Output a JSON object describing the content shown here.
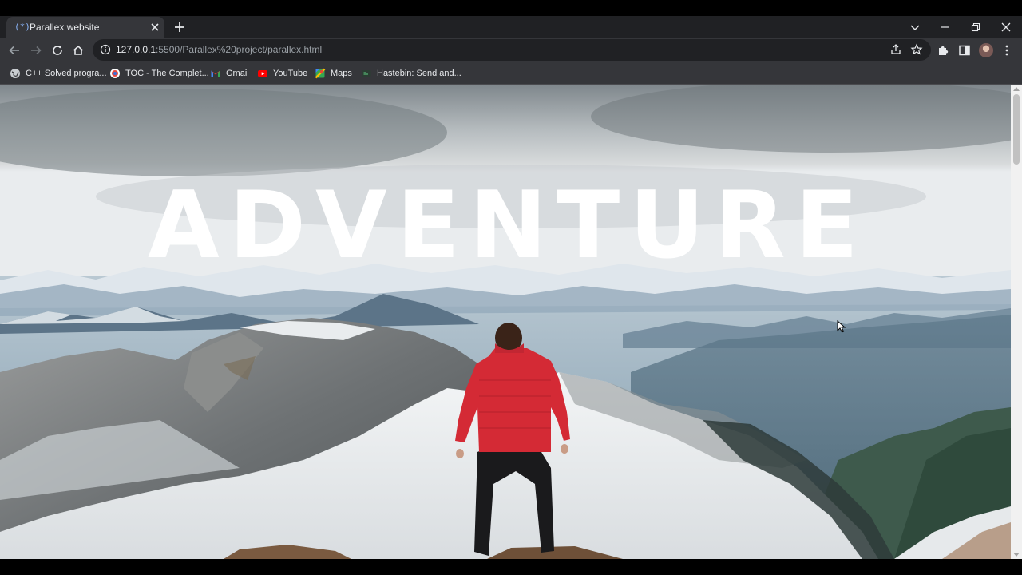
{
  "browser": {
    "tab": {
      "title": "Parallex website",
      "favicon": "code-favicon-icon",
      "favicon_glyph": "(*)"
    },
    "address": {
      "host": "127.0.0.1",
      "path": ":5500/Parallex%20project/parallex.html"
    },
    "bookmarks": [
      {
        "label": "C++ Solved progra...",
        "icon": "globe-icon"
      },
      {
        "label": "TOC - The Complet...",
        "icon": "site-favicon-icon"
      },
      {
        "label": "Gmail",
        "icon": "gmail-icon"
      },
      {
        "label": "YouTube",
        "icon": "youtube-icon"
      },
      {
        "label": "Maps",
        "icon": "maps-icon"
      },
      {
        "label": "Hastebin: Send and...",
        "icon": "hastebin-icon"
      }
    ]
  },
  "page": {
    "headline": "ADVENTURE",
    "hero_image": "mountain-hiker-red-jacket"
  },
  "colors": {
    "tab_strip": "#202124",
    "toolbar": "#35363a",
    "headline": "#ffffff",
    "jacket": "#d42a35"
  }
}
